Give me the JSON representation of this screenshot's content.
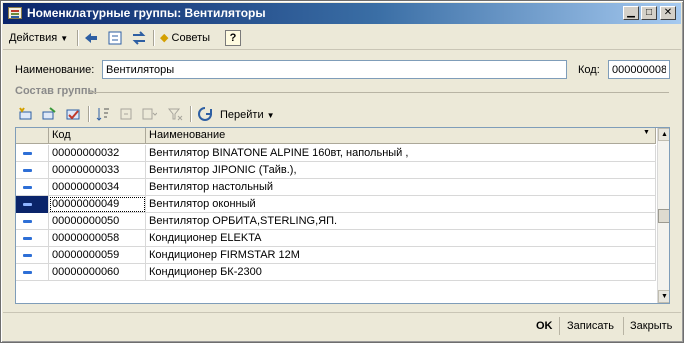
{
  "window": {
    "title": "Номенклатурные группы: Вентиляторы"
  },
  "toolbar": {
    "actions_label": "Действия",
    "advice_label": "Советы",
    "help_label": "?"
  },
  "form": {
    "name_label": "Наименование:",
    "name_value": "Вентиляторы",
    "code_label": "Код:",
    "code_value": "000000008"
  },
  "group": {
    "title": "Состав группы",
    "goto_label": "Перейти"
  },
  "table": {
    "columns": [
      "Код",
      "Наименование"
    ],
    "selected_index": 3,
    "rows": [
      {
        "code": "00000000032",
        "name": "Вентилятор BINATONE ALPINE 160вт, напольный ,"
      },
      {
        "code": "00000000033",
        "name": "Вентилятор JIPONIC (Тайв.),"
      },
      {
        "code": "00000000034",
        "name": "Вентилятор настольный"
      },
      {
        "code": "00000000049",
        "name": "Вентилятор оконный"
      },
      {
        "code": "00000000050",
        "name": "Вентилятор ОРБИТА,STERLING,ЯП."
      },
      {
        "code": "00000000058",
        "name": "Кондиционер ELEKTA"
      },
      {
        "code": "00000000059",
        "name": "Кондиционер FIRMSTAR 12M"
      },
      {
        "code": "00000000060",
        "name": "Кондиционер БК-2300"
      }
    ]
  },
  "footer": {
    "ok_label": "OK",
    "save_label": "Записать",
    "close_label": "Закрыть"
  }
}
